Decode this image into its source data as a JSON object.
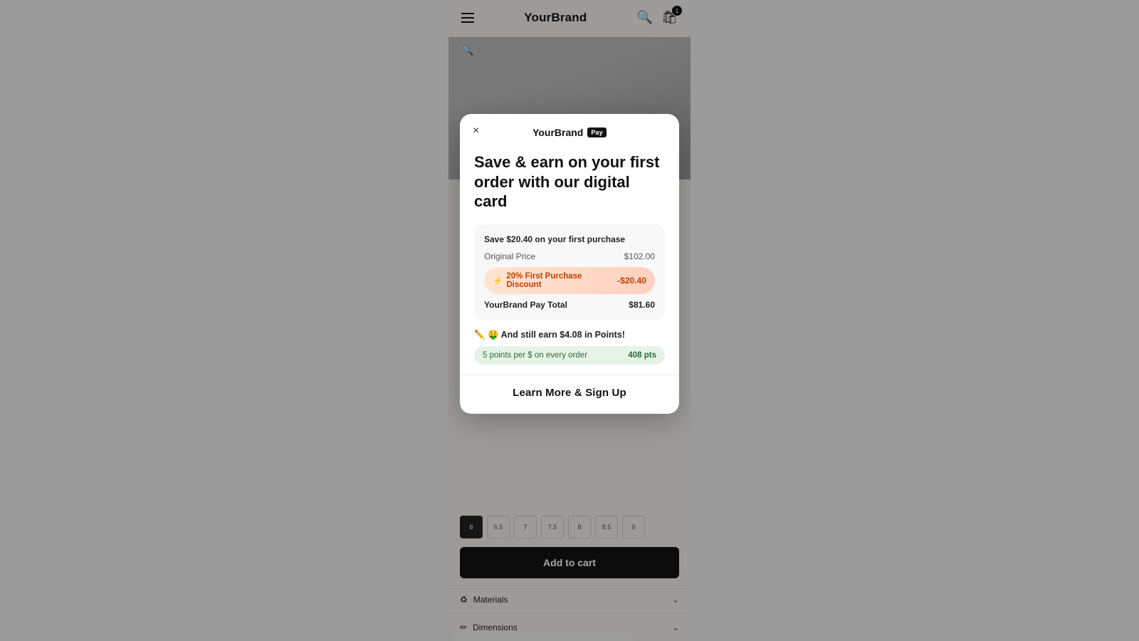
{
  "header": {
    "brand": "YourBrand",
    "hamburger_label": "menu",
    "search_label": "search",
    "cart_label": "cart",
    "cart_count": "1"
  },
  "modal": {
    "brand_name": "YourBrand",
    "brand_pay_label": "Pay",
    "close_label": "×",
    "title": "Save & earn on your first order with our digital card",
    "pricing": {
      "section_title": "Save $20.40 on your first purchase",
      "original_price_label": "Original Price",
      "original_price_value": "$102.00",
      "discount_icon": "⚡",
      "discount_label": "20% First Purchase Discount",
      "discount_value": "-$20.40",
      "total_label": "YourBrand Pay Total",
      "total_value": "$81.60"
    },
    "points": {
      "header": "✏️ 🤑 And still earn $4.08 in Points!",
      "per_dollar_label": "5 points per $ on every order",
      "points_value": "408 pts"
    },
    "cta_label": "Learn More & Sign Up"
  },
  "bottom": {
    "sizes": [
      "6",
      "6.5",
      "7",
      "7.5",
      "8",
      "8.5",
      "9"
    ],
    "selected_size_index": 0,
    "add_to_cart_label": "Add to cart",
    "accordion_items": [
      {
        "label": "Materials",
        "icon": "♻"
      },
      {
        "label": "Dimensions",
        "icon": "✏"
      }
    ]
  }
}
